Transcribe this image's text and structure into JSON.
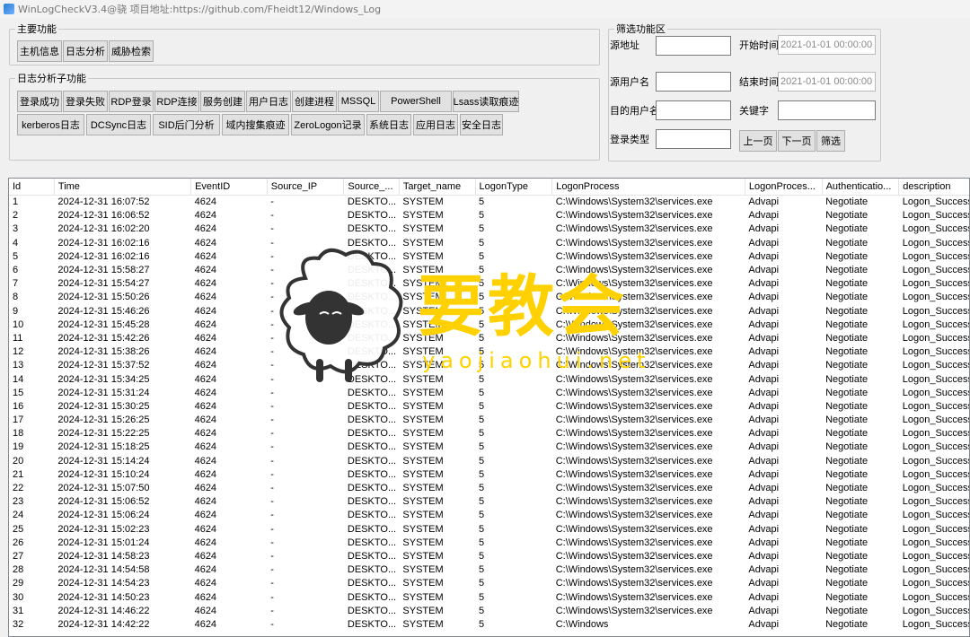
{
  "window": {
    "title": "WinLogCheckV3.4@骁 项目地址:https://github.com/Fheidt12/Windows_Log"
  },
  "main_functions": {
    "legend": "主要功能",
    "buttons": [
      "主机信息",
      "日志分析",
      "威胁检索"
    ]
  },
  "sub_functions": {
    "legend": "日志分析子功能",
    "row1": [
      "登录成功",
      "登录失败",
      "RDP登录",
      "RDP连接",
      "服务创建",
      "用户日志",
      "创建进程",
      "MSSQL",
      "PowerShell",
      "Lsass读取痕迹"
    ],
    "row2": [
      "kerberos日志",
      "DCSync日志",
      "SID后门分析",
      "域内搜集痕迹",
      "ZeroLogon记录",
      "系统日志",
      "应用日志",
      "安全日志"
    ]
  },
  "filter": {
    "legend": "筛选功能区",
    "source_addr_label": "源地址",
    "source_user_label": "源用户名",
    "target_user_label": "目的用户名",
    "logon_type_label": "登录类型",
    "start_time_label": "开始时间",
    "start_time_value": "2021-01-01 00:00:00",
    "end_time_label": "结束时间",
    "end_time_value": "2021-01-01 00:00:00",
    "keyword_label": "关键字",
    "prev_label": "上一页",
    "next_label": "下一页",
    "filter_label": "筛选"
  },
  "table": {
    "columns": [
      "Id",
      "Time",
      "EventID",
      "Source_IP",
      "Source_...",
      "Target_name",
      "LogonType",
      "LogonProcess",
      "LogonProces...",
      "Authenticatio...",
      "description"
    ],
    "rows": [
      [
        "1",
        "2024-12-31 16:07:52",
        "4624",
        "-",
        "DESKTO...",
        "SYSTEM",
        "5",
        "C:\\Windows\\System32\\services.exe",
        "Advapi",
        "Negotiate",
        "Logon_Success"
      ],
      [
        "2",
        "2024-12-31 16:06:52",
        "4624",
        "-",
        "DESKTO...",
        "SYSTEM",
        "5",
        "C:\\Windows\\System32\\services.exe",
        "Advapi",
        "Negotiate",
        "Logon_Success"
      ],
      [
        "3",
        "2024-12-31 16:02:20",
        "4624",
        "-",
        "DESKTO...",
        "SYSTEM",
        "5",
        "C:\\Windows\\System32\\services.exe",
        "Advapi",
        "Negotiate",
        "Logon_Success"
      ],
      [
        "4",
        "2024-12-31 16:02:16",
        "4624",
        "-",
        "DESKTO...",
        "SYSTEM",
        "5",
        "C:\\Windows\\System32\\services.exe",
        "Advapi",
        "Negotiate",
        "Logon_Success"
      ],
      [
        "5",
        "2024-12-31 16:02:16",
        "4624",
        "-",
        "DESKTO...",
        "SYSTEM",
        "5",
        "C:\\Windows\\System32\\services.exe",
        "Advapi",
        "Negotiate",
        "Logon_Success"
      ],
      [
        "6",
        "2024-12-31 15:58:27",
        "4624",
        "-",
        "DESKTO...",
        "SYSTEM",
        "5",
        "C:\\Windows\\System32\\services.exe",
        "Advapi",
        "Negotiate",
        "Logon_Success"
      ],
      [
        "7",
        "2024-12-31 15:54:27",
        "4624",
        "-",
        "DESKTO...",
        "SYSTEM",
        "5",
        "C:\\Windows\\System32\\services.exe",
        "Advapi",
        "Negotiate",
        "Logon_Success"
      ],
      [
        "8",
        "2024-12-31 15:50:26",
        "4624",
        "-",
        "DESKTO...",
        "SYSTEM",
        "5",
        "C:\\Windows\\System32\\services.exe",
        "Advapi",
        "Negotiate",
        "Logon_Success"
      ],
      [
        "9",
        "2024-12-31 15:46:26",
        "4624",
        "-",
        "DESKTO...",
        "SYSTEM",
        "5",
        "C:\\Windows\\System32\\services.exe",
        "Advapi",
        "Negotiate",
        "Logon_Success"
      ],
      [
        "10",
        "2024-12-31 15:45:28",
        "4624",
        "-",
        "DESKTO...",
        "SYSTEM",
        "5",
        "C:\\Windows\\System32\\services.exe",
        "Advapi",
        "Negotiate",
        "Logon_Success"
      ],
      [
        "11",
        "2024-12-31 15:42:26",
        "4624",
        "-",
        "DESKTO...",
        "SYSTEM",
        "5",
        "C:\\Windows\\System32\\services.exe",
        "Advapi",
        "Negotiate",
        "Logon_Success"
      ],
      [
        "12",
        "2024-12-31 15:38:26",
        "4624",
        "-",
        "DESKTO...",
        "SYSTEM",
        "5",
        "C:\\Windows\\System32\\services.exe",
        "Advapi",
        "Negotiate",
        "Logon_Success"
      ],
      [
        "13",
        "2024-12-31 15:37:52",
        "4624",
        "-",
        "DESKTO...",
        "SYSTEM",
        "5",
        "C:\\Windows\\System32\\services.exe",
        "Advapi",
        "Negotiate",
        "Logon_Success"
      ],
      [
        "14",
        "2024-12-31 15:34:25",
        "4624",
        "-",
        "DESKTO...",
        "SYSTEM",
        "5",
        "C:\\Windows\\System32\\services.exe",
        "Advapi",
        "Negotiate",
        "Logon_Success"
      ],
      [
        "15",
        "2024-12-31 15:31:24",
        "4624",
        "-",
        "DESKTO...",
        "SYSTEM",
        "5",
        "C:\\Windows\\System32\\services.exe",
        "Advapi",
        "Negotiate",
        "Logon_Success"
      ],
      [
        "16",
        "2024-12-31 15:30:25",
        "4624",
        "-",
        "DESKTO...",
        "SYSTEM",
        "5",
        "C:\\Windows\\System32\\services.exe",
        "Advapi",
        "Negotiate",
        "Logon_Success"
      ],
      [
        "17",
        "2024-12-31 15:26:25",
        "4624",
        "-",
        "DESKTO...",
        "SYSTEM",
        "5",
        "C:\\Windows\\System32\\services.exe",
        "Advapi",
        "Negotiate",
        "Logon_Success"
      ],
      [
        "18",
        "2024-12-31 15:22:25",
        "4624",
        "-",
        "DESKTO...",
        "SYSTEM",
        "5",
        "C:\\Windows\\System32\\services.exe",
        "Advapi",
        "Negotiate",
        "Logon_Success"
      ],
      [
        "19",
        "2024-12-31 15:18:25",
        "4624",
        "-",
        "DESKTO...",
        "SYSTEM",
        "5",
        "C:\\Windows\\System32\\services.exe",
        "Advapi",
        "Negotiate",
        "Logon_Success"
      ],
      [
        "20",
        "2024-12-31 15:14:24",
        "4624",
        "-",
        "DESKTO...",
        "SYSTEM",
        "5",
        "C:\\Windows\\System32\\services.exe",
        "Advapi",
        "Negotiate",
        "Logon_Success"
      ],
      [
        "21",
        "2024-12-31 15:10:24",
        "4624",
        "-",
        "DESKTO...",
        "SYSTEM",
        "5",
        "C:\\Windows\\System32\\services.exe",
        "Advapi",
        "Negotiate",
        "Logon_Success"
      ],
      [
        "22",
        "2024-12-31 15:07:50",
        "4624",
        "-",
        "DESKTO...",
        "SYSTEM",
        "5",
        "C:\\Windows\\System32\\services.exe",
        "Advapi",
        "Negotiate",
        "Logon_Success"
      ],
      [
        "23",
        "2024-12-31 15:06:52",
        "4624",
        "-",
        "DESKTO...",
        "SYSTEM",
        "5",
        "C:\\Windows\\System32\\services.exe",
        "Advapi",
        "Negotiate",
        "Logon_Success"
      ],
      [
        "24",
        "2024-12-31 15:06:24",
        "4624",
        "-",
        "DESKTO...",
        "SYSTEM",
        "5",
        "C:\\Windows\\System32\\services.exe",
        "Advapi",
        "Negotiate",
        "Logon_Success"
      ],
      [
        "25",
        "2024-12-31 15:02:23",
        "4624",
        "-",
        "DESKTO...",
        "SYSTEM",
        "5",
        "C:\\Windows\\System32\\services.exe",
        "Advapi",
        "Negotiate",
        "Logon_Success"
      ],
      [
        "26",
        "2024-12-31 15:01:24",
        "4624",
        "-",
        "DESKTO...",
        "SYSTEM",
        "5",
        "C:\\Windows\\System32\\services.exe",
        "Advapi",
        "Negotiate",
        "Logon_Success"
      ],
      [
        "27",
        "2024-12-31 14:58:23",
        "4624",
        "-",
        "DESKTO...",
        "SYSTEM",
        "5",
        "C:\\Windows\\System32\\services.exe",
        "Advapi",
        "Negotiate",
        "Logon_Success"
      ],
      [
        "28",
        "2024-12-31 14:54:58",
        "4624",
        "-",
        "DESKTO...",
        "SYSTEM",
        "5",
        "C:\\Windows\\System32\\services.exe",
        "Advapi",
        "Negotiate",
        "Logon_Success"
      ],
      [
        "29",
        "2024-12-31 14:54:23",
        "4624",
        "-",
        "DESKTO...",
        "SYSTEM",
        "5",
        "C:\\Windows\\System32\\services.exe",
        "Advapi",
        "Negotiate",
        "Logon_Success"
      ],
      [
        "30",
        "2024-12-31 14:50:23",
        "4624",
        "-",
        "DESKTO...",
        "SYSTEM",
        "5",
        "C:\\Windows\\System32\\services.exe",
        "Advapi",
        "Negotiate",
        "Logon_Success"
      ],
      [
        "31",
        "2024-12-31 14:46:22",
        "4624",
        "-",
        "DESKTO...",
        "SYSTEM",
        "5",
        "C:\\Windows\\System32\\services.exe",
        "Advapi",
        "Negotiate",
        "Logon_Success"
      ],
      [
        "32",
        "2024-12-31 14:42:22",
        "4624",
        "-",
        "DESKTO...",
        "SYSTEM",
        "5",
        "C:\\Windows",
        "Advapi",
        "Negotiate",
        "Logon_Success"
      ]
    ]
  },
  "watermark": {
    "text_zh": "要教会",
    "text_en": "yaojiaohui.net"
  },
  "colors": {
    "watermark": "#ffd100",
    "button_bg": "#e1e1e1",
    "window_bg": "#f0f0f0"
  }
}
